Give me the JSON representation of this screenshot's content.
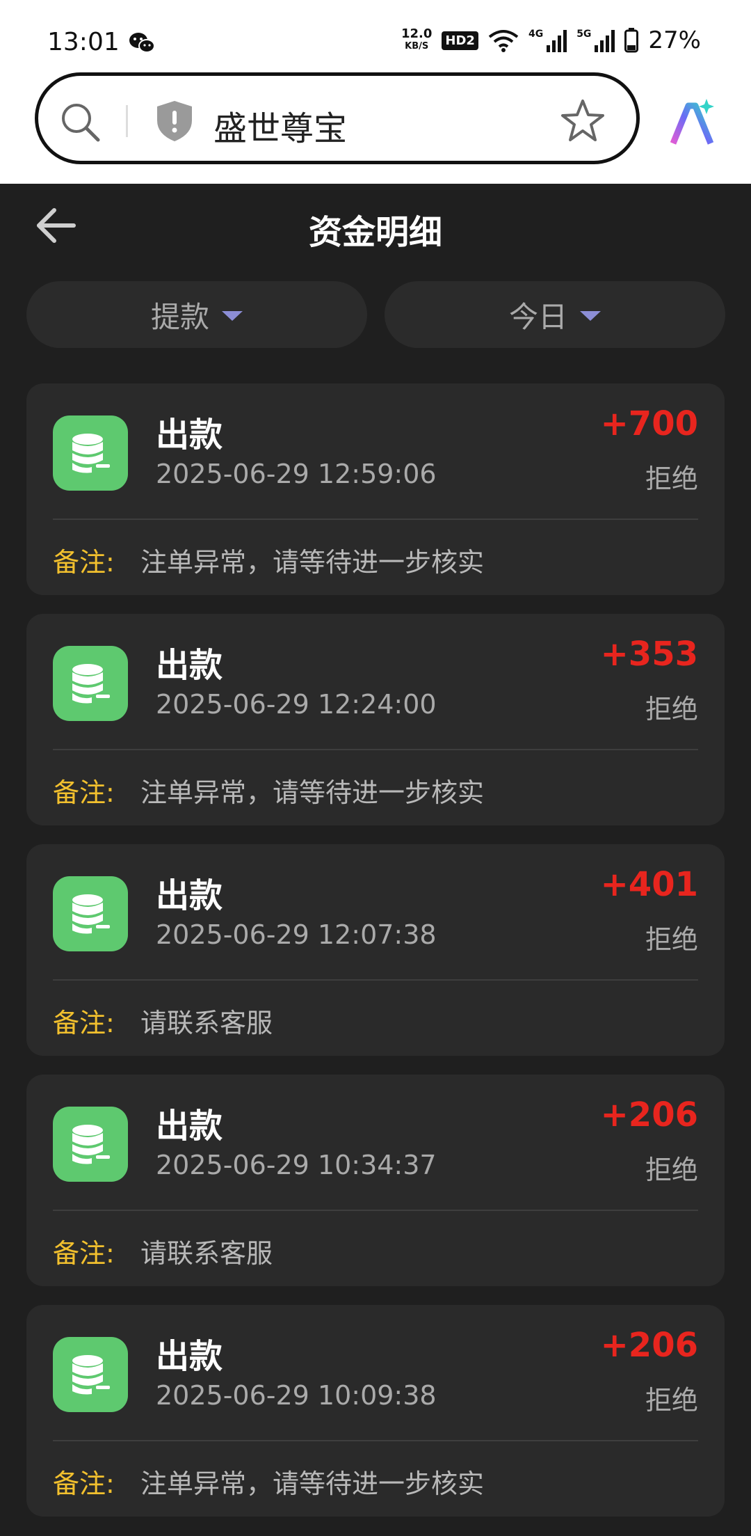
{
  "status_bar": {
    "time": "13:01",
    "speed_value": "12.0",
    "speed_unit": "KB/S",
    "hd": "HD2",
    "net_4g": "4G",
    "net_5g": "5G",
    "battery": "27%"
  },
  "browser": {
    "site_title": "盛世尊宝"
  },
  "header": {
    "title": "资金明细"
  },
  "filters": {
    "type_label": "提款",
    "date_label": "今日"
  },
  "colors": {
    "accent_green": "#5ec96f",
    "amount_red": "#e8251e",
    "note_label_yellow": "#f2c02e"
  },
  "records": [
    {
      "type": "出款",
      "time": "2025-06-29 12:59:06",
      "amount": "+700",
      "status": "拒绝",
      "note_label": "备注:",
      "note": "注单异常，请等待进一步核实"
    },
    {
      "type": "出款",
      "time": "2025-06-29 12:24:00",
      "amount": "+353",
      "status": "拒绝",
      "note_label": "备注:",
      "note": "注单异常，请等待进一步核实"
    },
    {
      "type": "出款",
      "time": "2025-06-29 12:07:38",
      "amount": "+401",
      "status": "拒绝",
      "note_label": "备注:",
      "note": "请联系客服"
    },
    {
      "type": "出款",
      "time": "2025-06-29 10:34:37",
      "amount": "+206",
      "status": "拒绝",
      "note_label": "备注:",
      "note": "请联系客服"
    },
    {
      "type": "出款",
      "time": "2025-06-29 10:09:38",
      "amount": "+206",
      "status": "拒绝",
      "note_label": "备注:",
      "note": "注单异常，请等待进一步核实"
    }
  ]
}
